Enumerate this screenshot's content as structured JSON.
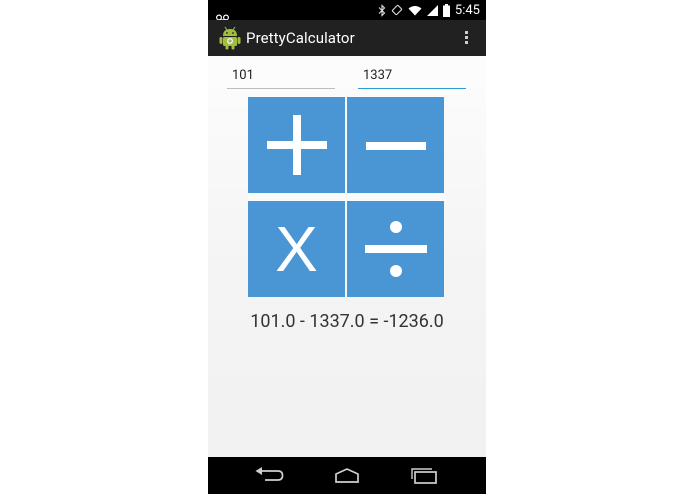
{
  "status_bar": {
    "time": "5:45",
    "icons": [
      "voicemail-icon",
      "bluetooth-icon",
      "vibrate-icon",
      "wifi-icon",
      "signal-icon",
      "battery-icon"
    ]
  },
  "app_bar": {
    "title": "PrettyCalculator",
    "logo_icon": "android-icon",
    "menu_icon": "overflow-menu-icon"
  },
  "inputs": {
    "first": "101",
    "second": "1337"
  },
  "operations": {
    "add": "+",
    "subtract": "−",
    "multiply": "X",
    "divide": "÷"
  },
  "result": "101.0 - 1337.0 = -1236.0",
  "nav_bar": {
    "icons": [
      "back-icon",
      "home-icon",
      "recent-apps-icon"
    ]
  },
  "colors": {
    "button": "#4a96d4",
    "focus_underline": "#2a9fd6",
    "action_bar": "#212121"
  }
}
